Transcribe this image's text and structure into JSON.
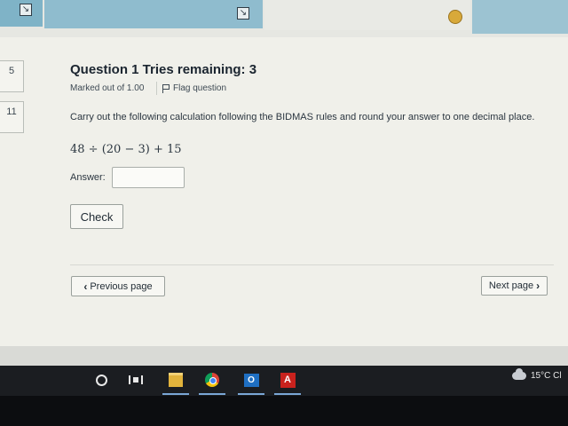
{
  "nav": {
    "tiles": [
      "5",
      "11"
    ]
  },
  "question": {
    "title": "Question 1 Tries remaining: 3",
    "marked": "Marked out of 1.00",
    "flag_label": "Flag question",
    "text": "Carry out the following calculation following the BIDMAS rules and round your answer to one decimal place.",
    "formula": "48 ÷ (20 − 3) + 15",
    "answer_label": "Answer:",
    "answer_value": "",
    "check_label": "Check"
  },
  "pager": {
    "previous_label": "Previous page",
    "next_label": "Next page"
  },
  "taskbar": {
    "apps": [
      "cortana-icon",
      "task-view-icon",
      "file-explorer-icon",
      "chrome-icon",
      "outlook-icon",
      "acrobat-icon"
    ],
    "weather": "15°C Cl"
  },
  "colors": {
    "page_bg": "#f0f0ea",
    "topbar_accent": "#8fbcce",
    "taskbar_bg": "#1b1d21"
  }
}
